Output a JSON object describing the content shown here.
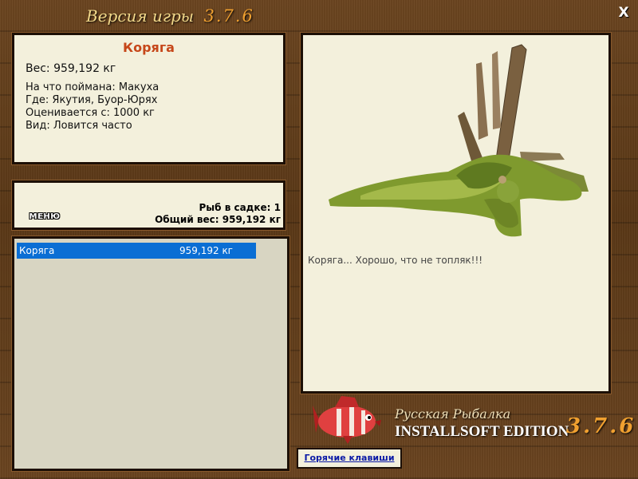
{
  "header": {
    "version_label": "Версия игры",
    "version_number": "3.7.6",
    "close_label": "X"
  },
  "fish_info": {
    "name": "Коряга",
    "weight": "Вес: 959,192 кг",
    "caught_on": "На что поймана: Макуха",
    "location": "Где: Якутия, Буор-Юрях",
    "valued_from": "Оценивается с: 1000 кг",
    "frequency": "Вид: Ловится часто"
  },
  "keepnet": {
    "menu_label": "МЕНЮ",
    "fish_count": "Рыб в садке: 1",
    "total_weight": "Общий вес: 959,192 кг"
  },
  "catch_list": [
    {
      "name": "Коряга",
      "weight": "959,192 кг"
    }
  ],
  "image_panel": {
    "caption": "Коряга... Хорошо, что не топляк!!!"
  },
  "branding": {
    "subtitle": "Русская Рыбалка",
    "edition": "INSTALLSOFT EDITION",
    "version": "3.7.6"
  },
  "hotkeys_label": "Горячие клавиши"
}
